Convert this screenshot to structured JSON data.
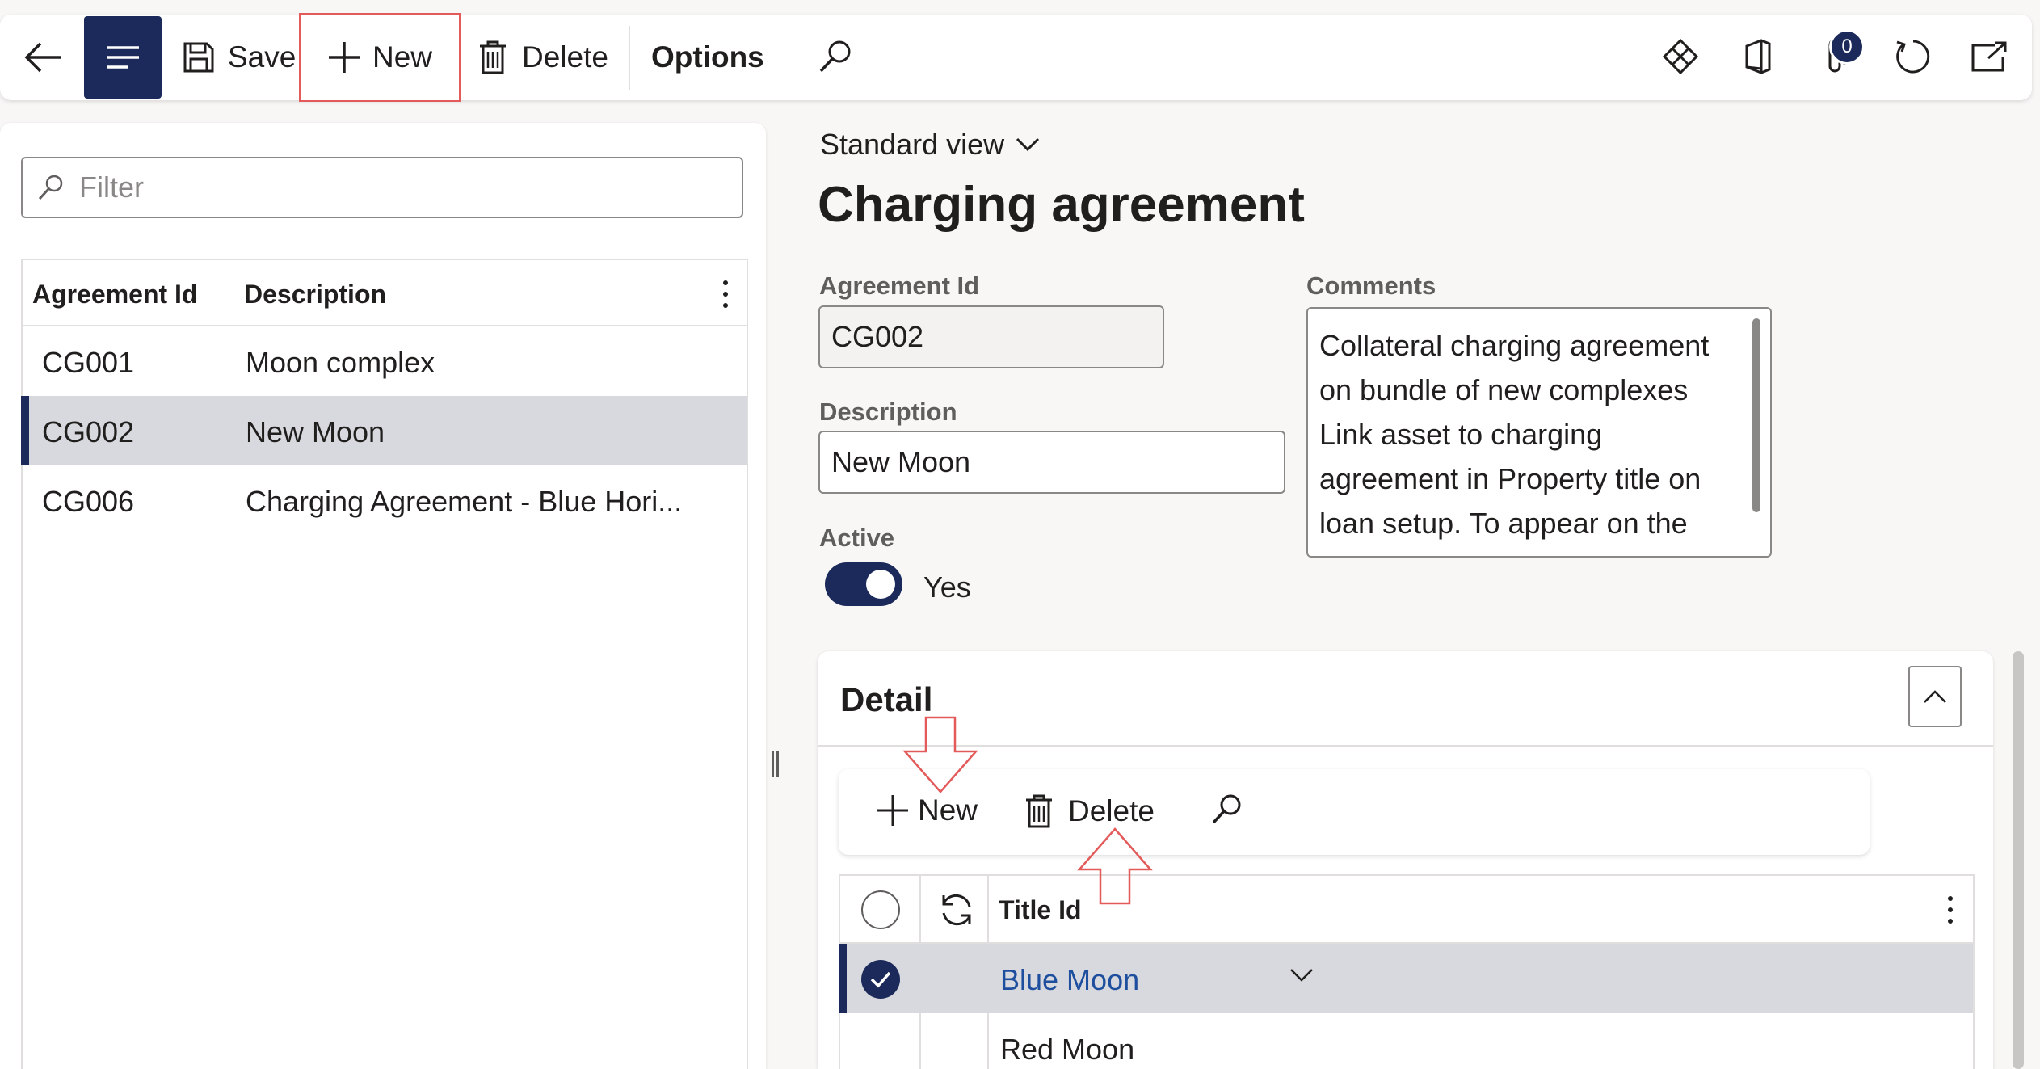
{
  "toolbar": {
    "save_label": "Save",
    "new_label": "New",
    "delete_label": "Delete",
    "options_label": "Options",
    "attachments_count": "0"
  },
  "list": {
    "filter_placeholder": "Filter",
    "headers": {
      "id": "Agreement Id",
      "description": "Description"
    },
    "rows": [
      {
        "id": "CG001",
        "description": "Moon complex"
      },
      {
        "id": "CG002",
        "description": "New Moon"
      },
      {
        "id": "CG006",
        "description": "Charging Agreement - Blue Hori..."
      }
    ]
  },
  "form": {
    "view_name": "Standard view",
    "title": "Charging agreement",
    "agreement_id_label": "Agreement Id",
    "agreement_id_value": "CG002",
    "description_label": "Description",
    "description_value": "New Moon",
    "active_label": "Active",
    "active_value": "Yes",
    "comments_label": "Comments",
    "comments_value": "Collateral charging agreement on bundle of new complexes Link asset to charging agreement in Property title on loan setup.  To appear on the"
  },
  "detail": {
    "title": "Detail",
    "new_label": "New",
    "delete_label": "Delete",
    "column_header": "Title Id",
    "rows": [
      {
        "title_id": "Blue Moon"
      },
      {
        "title_id": "Red Moon"
      }
    ]
  },
  "icons": {
    "back": "back-arrow-icon",
    "menu": "hamburger-icon",
    "save": "save-icon",
    "add": "plus-icon",
    "delete": "trash-icon",
    "search": "search-icon",
    "diamond": "diamond-icon",
    "office": "office-icon",
    "attachment": "paperclip-icon",
    "refresh": "refresh-icon",
    "popout": "popout-icon"
  },
  "colors": {
    "accent": "#1b2a5a",
    "link": "#1e4e9e",
    "highlight": "#e35a5a",
    "selected_row": "#d8d9de"
  }
}
